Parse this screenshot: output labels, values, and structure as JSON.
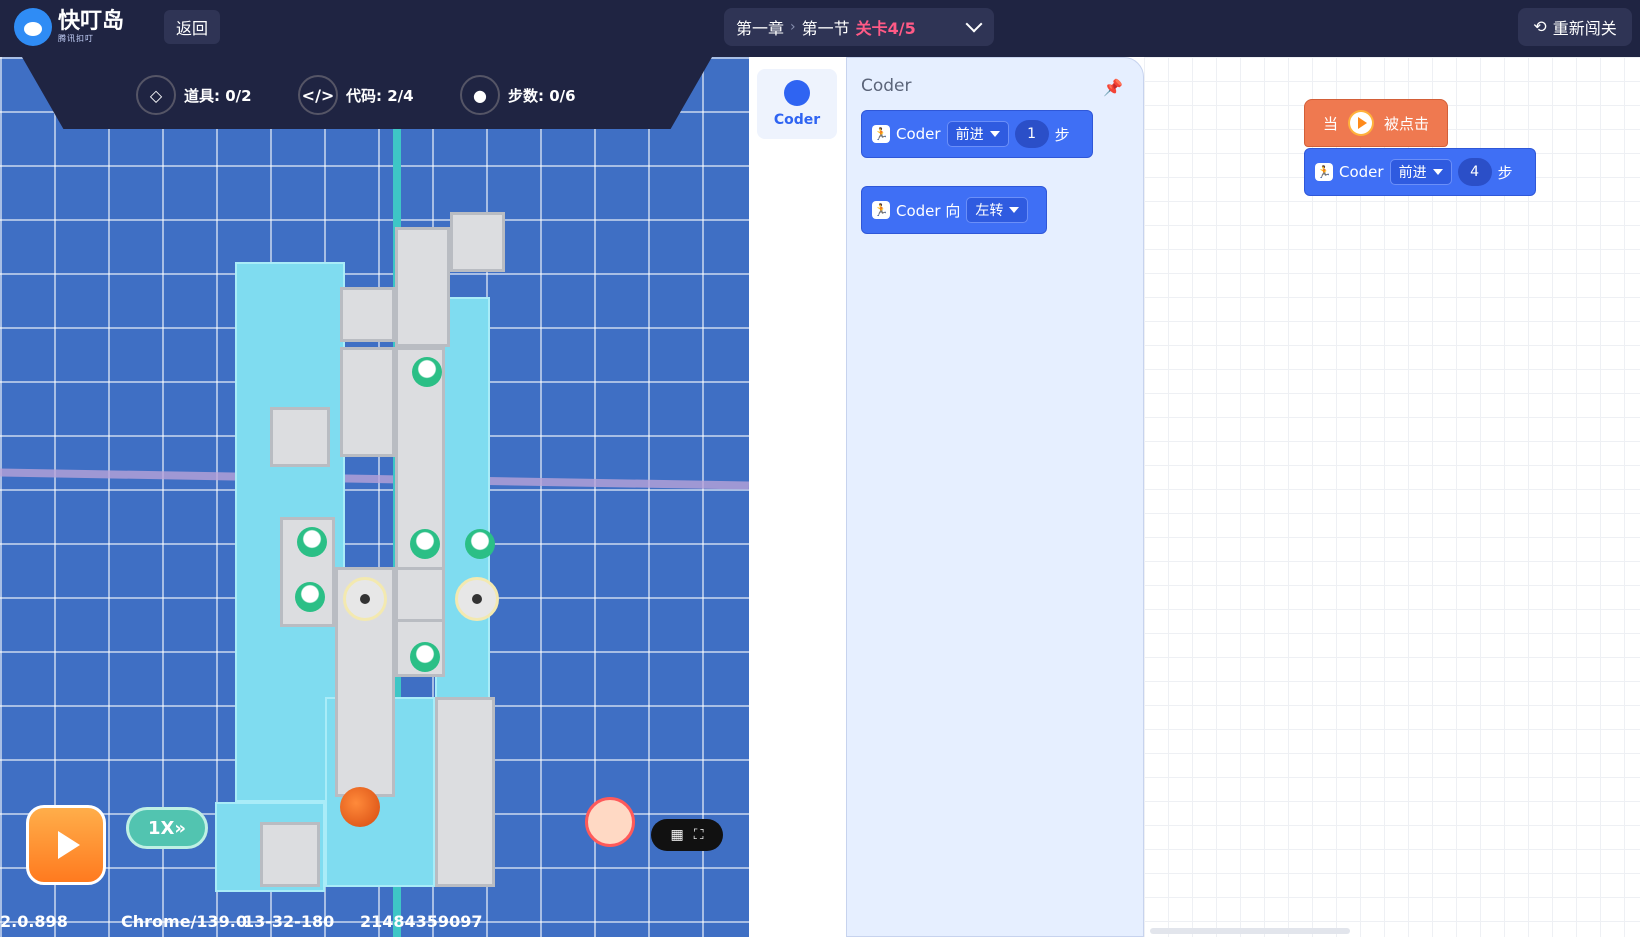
{
  "app": {
    "name": "快叮岛",
    "slogan": "腾讯扣叮"
  },
  "header": {
    "back_label": "返回",
    "chapter": "第一章",
    "section": "第一节",
    "level": "关卡4/5",
    "restart_label": "重新闯关"
  },
  "hud": {
    "items_label": "道具: 0/2",
    "code_label": "代码: 2/4",
    "steps_label": "步数: 0/6"
  },
  "controls": {
    "speed_label": "1X"
  },
  "footer": {
    "version": "2.0.898",
    "browser": "Chrome/139.0",
    "time": "13-32-180",
    "id": "21484359097"
  },
  "palette": {
    "category_label": "Coder",
    "flyout_title": "Coder",
    "block1": {
      "actor": "Coder",
      "action": "前进",
      "count": "1",
      "unit": "步"
    },
    "block2": {
      "actor": "Coder 向",
      "direction": "左转"
    }
  },
  "workspace": {
    "hat": {
      "prefix": "当",
      "suffix": "被点击"
    },
    "move_block": {
      "actor": "Coder",
      "action": "前进",
      "count": "4",
      "unit": "步"
    }
  },
  "colors": {
    "topbar": "#1f2442",
    "accent_pink": "#ff5a86",
    "block_blue": "#3f6ff5",
    "hat_orange": "#ef7950",
    "ice": "#7fdcf0",
    "grid_blue": "#3f6fc4"
  }
}
